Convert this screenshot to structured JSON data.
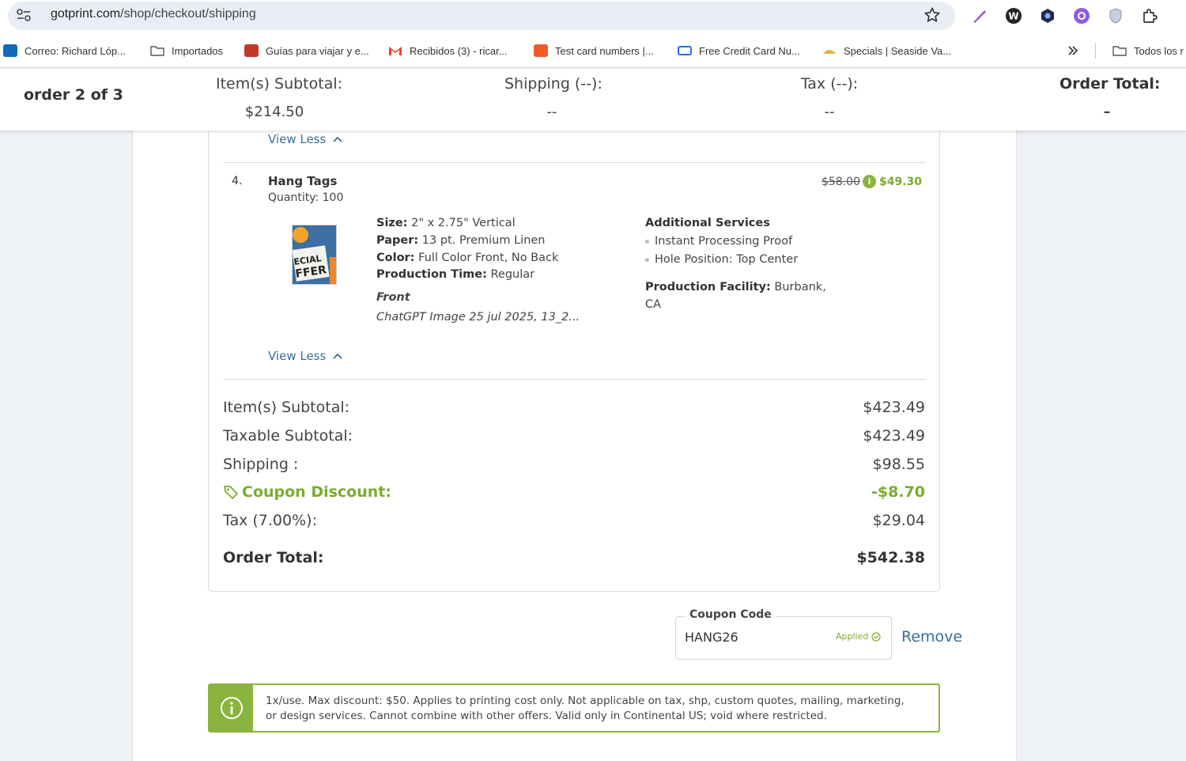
{
  "browser": {
    "url_domain": "gotprint.com",
    "url_path": "/shop/checkout/shipping",
    "bookmarks": [
      {
        "label": "Correo: Richard Lóp...",
        "icon": "outlook-icon",
        "color": "#0f6cbd"
      },
      {
        "label": "Importados",
        "icon": "folder-icon",
        "color": "#555555"
      },
      {
        "label": "Guías para viajar y e...",
        "icon": "travel-guide-icon",
        "color": "#c0392b"
      },
      {
        "label": "Recibidos (3) - ricar...",
        "icon": "gmail-icon",
        "color": "#ea4335"
      },
      {
        "label": "Test card numbers |...",
        "icon": "test-card-icon",
        "color": "#f05a28"
      },
      {
        "label": "Free Credit Card Nu...",
        "icon": "credit-card-icon",
        "color": "#1a73e8"
      },
      {
        "label": "Specials | Seaside Va...",
        "icon": "seaside-icon",
        "color": "#e0b33c"
      },
      {
        "label": "Todos los r",
        "icon": "folder-icon",
        "color": "#555555"
      }
    ]
  },
  "order_bar": {
    "title": "order 2 of 3",
    "subtotal_label": "Item(s) Subtotal:",
    "subtotal_value": "$214.50",
    "shipping_label": "Shipping (--):",
    "shipping_value": "--",
    "tax_label": "Tax (--):",
    "tax_value": "--",
    "total_label": "Order Total:",
    "total_value": "–"
  },
  "item": {
    "view_less_top": "View Less",
    "number": "4.",
    "name": "Hang Tags",
    "quantity": "Quantity: 100",
    "price_old": "$58.00",
    "price_info": "i",
    "price_new": "$49.30",
    "thumb_text": "ECIAL FFER",
    "specs": [
      {
        "label": "Size:",
        "value": " 2\" x 2.75\" Vertical"
      },
      {
        "label": "Paper:",
        "value": " 13 pt. Premium Linen"
      },
      {
        "label": "Color:",
        "value": " Full Color Front, No Back"
      },
      {
        "label": "Production Time:",
        "value": " Regular"
      }
    ],
    "front_label": "Front",
    "front_file": "ChatGPT Image 25 jul 2025, 13_2...",
    "additional_title": "Additional Services",
    "additional_items": [
      "Instant Processing Proof",
      "Hole Position: Top Center"
    ],
    "facility_label": "Production Facility:",
    "facility_value": " Burbank, CA",
    "view_less_bottom": "View Less"
  },
  "summary": {
    "subtotal_label": "Item(s) Subtotal:",
    "subtotal_value": "$423.49",
    "taxable_label": "Taxable Subtotal:",
    "taxable_value": "$423.49",
    "shipping_label": "Shipping :",
    "shipping_value": "$98.55",
    "coupon_label": "Coupon Discount:",
    "coupon_value": "-$8.70",
    "tax_label": "Tax (7.00%):",
    "tax_value": "$29.04",
    "total_label": "Order Total:",
    "total_value": "$542.38"
  },
  "coupon": {
    "legend": "Coupon Code",
    "value": "HANG26",
    "status": "Applied",
    "remove_label": "Remove"
  },
  "banner": {
    "text": "1x/use. Max discount: $50. Applies to printing cost only. Not applicable on tax, shp, custom quotes, mailing, marketing, or design services. Cannot combine with other offers. Valid only in Continental US; void where restricted."
  },
  "colors": {
    "accent_green": "#7cab2e",
    "link_blue": "#3a6f93"
  }
}
